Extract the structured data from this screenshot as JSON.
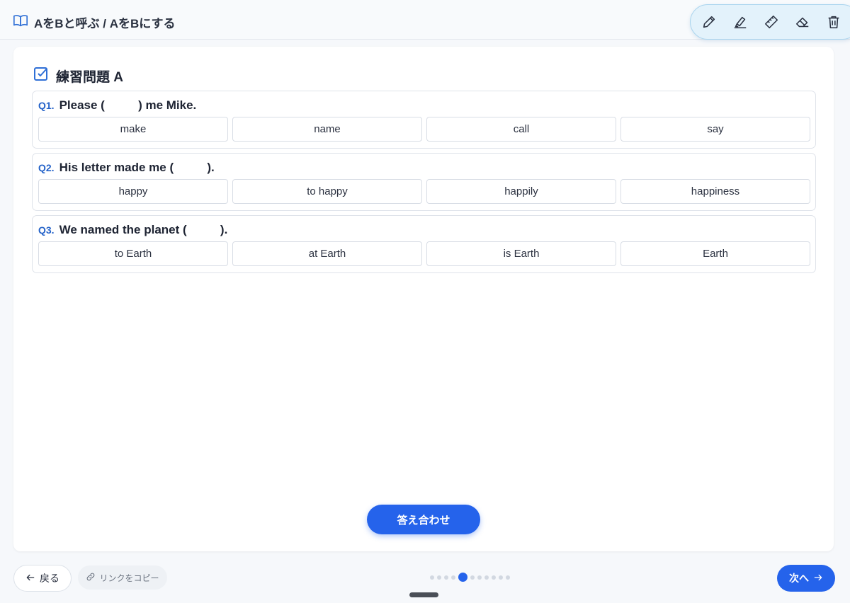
{
  "header": {
    "title": "AをBと呼ぶ / AをBにする"
  },
  "toolbar": {
    "tools": [
      "pencil-icon",
      "highlighter-icon",
      "ruler-icon",
      "eraser-icon",
      "trash-icon"
    ]
  },
  "section": {
    "title": "練習問題 A"
  },
  "questions": [
    {
      "num": "Q1.",
      "text": "Please (          ) me Mike.",
      "choices": [
        "make",
        "name",
        "call",
        "say"
      ]
    },
    {
      "num": "Q2.",
      "text": "His letter made me (          ).",
      "choices": [
        "happy",
        "to happy",
        "happily",
        "happiness"
      ]
    },
    {
      "num": "Q3.",
      "text": "We named the planet (          ).",
      "choices": [
        "to Earth",
        "at Earth",
        "is Earth",
        "Earth"
      ]
    }
  ],
  "check_button": "答え合わせ",
  "footer": {
    "back_label": "戻る",
    "copy_link_label": "リンクをコピー",
    "next_label": "次へ",
    "page_dots": {
      "total": 11,
      "active_index": 4
    }
  },
  "colors": {
    "accent": "#2563eb",
    "question_number": "#2563c9",
    "toolbar_bg": "#e3f2fb"
  }
}
